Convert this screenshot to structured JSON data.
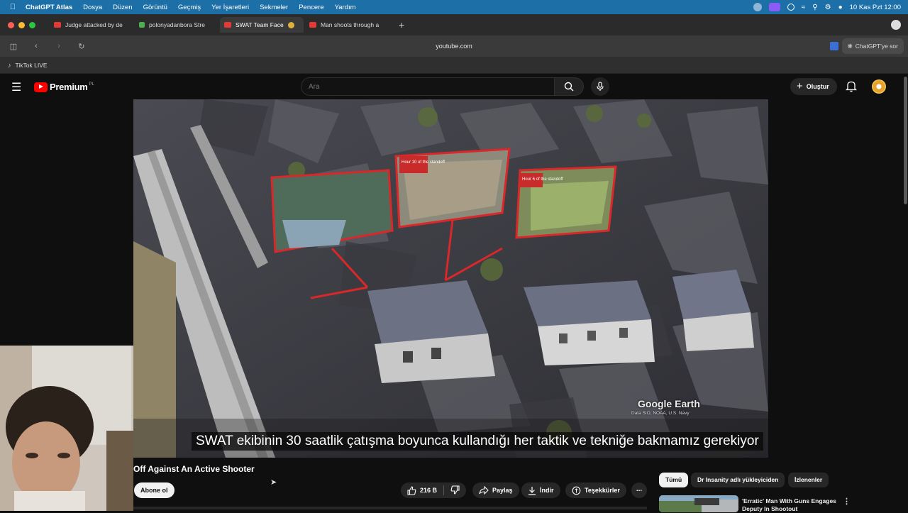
{
  "menubar": {
    "apple_icon": "apple-icon",
    "app_name": "ChatGPT Atlas",
    "menus": [
      "Dosya",
      "Düzen",
      "Görüntü",
      "Geçmiş",
      "Yer İşaretleri",
      "Sekmeler",
      "Pencere",
      "Yardım"
    ],
    "clock": "10 Kas Pzt  12:00"
  },
  "tabs": [
    {
      "title": "Judge attacked by de",
      "favicon": "youtube"
    },
    {
      "title": "polonyadanbora Stre",
      "favicon": "kick"
    },
    {
      "title": "SWAT Team Face",
      "favicon": "youtube",
      "active": true
    },
    {
      "title": "Man shoots through a",
      "favicon": "youtube"
    }
  ],
  "address": {
    "url": "youtube.com",
    "ask_button": "ChatGPT'ye sor"
  },
  "bookmarks": {
    "items": [
      "TikTok LIVE"
    ]
  },
  "youtube": {
    "logo_text": "Premium",
    "country_code": "PL",
    "search_placeholder": "Ara",
    "create_label": "Oluştur",
    "accent": "#ff0000"
  },
  "video": {
    "subtitle": "SWAT ekibinin 30 saatlik çatışma boyunca kullandığı her taktik ve tekniğe bakmamız gerekiyor",
    "watermark": "Google Earth",
    "watermark_source": "Data SIO, NOAA, U.S. Navy",
    "overlay_labels": [
      "Hour 10 of the standoff",
      "Hour 6 of the standoff"
    ]
  },
  "below_video": {
    "title": "Off Against An Active Shooter",
    "subscribe_label": "Abone ol",
    "like_count": "216 B",
    "share_label": "Paylaş",
    "download_label": "İndir",
    "thanks_label": "Teşekkürler",
    "more_label": "..."
  },
  "sidebar": {
    "chips": [
      "Tümü",
      "Dr Insanity adlı yükleyiciden",
      "İzlenenler"
    ],
    "recommendation": {
      "title": "'Erratic' Man With Guns Engages Deputy In Shootout"
    }
  }
}
